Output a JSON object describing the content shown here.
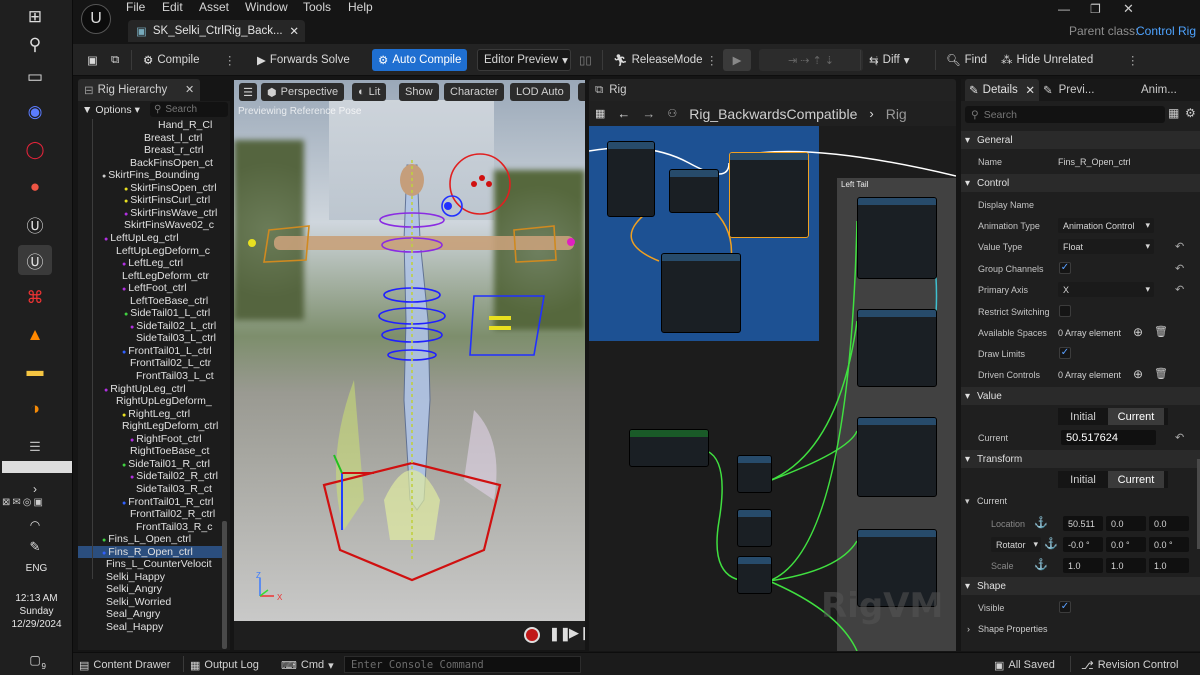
{
  "taskbar": {
    "lang": "ENG",
    "time": "12:13 AM",
    "day": "Sunday",
    "date": "12/29/2024",
    "notif_count": "9"
  },
  "menu": [
    "File",
    "Edit",
    "Asset",
    "Window",
    "Tools",
    "Help"
  ],
  "doc_tab": "SK_Selki_CtrlRig_Back...",
  "parent_class_label": "Parent class:",
  "parent_class_value": "Control Rig",
  "toolbar": {
    "compile": "Compile",
    "forwards_solve": "Forwards Solve",
    "auto_compile": "Auto Compile",
    "editor_preview": "Editor Preview",
    "release_mode": "ReleaseMode",
    "diff": "Diff",
    "find": "Find",
    "hide_unrelated": "Hide Unrelated"
  },
  "hierarchy": {
    "tab": "Rig Hierarchy",
    "options": "Options",
    "search_placeholder": "Search",
    "items": [
      "Hand_R_Cl",
      "Breast_l_ctrl",
      "Breast_r_ctrl",
      "BackFinsOpen_ct",
      "SkirtFins_Bounding",
      "SkirtFinsOpen_ctrl",
      "SkirtFinsCurl_ctrl",
      "SkirtFinsWave_ctrl",
      "SkirtFinsWave02_c",
      "LeftUpLeg_ctrl",
      "LeftUpLegDeform_c",
      "LeftLeg_ctrl",
      "LeftLegDeform_ctr",
      "LeftFoot_ctrl",
      "LeftToeBase_ctrl",
      "SideTail01_L_ctrl",
      "SideTail02_L_ctrl",
      "SideTail03_L_ctrl",
      "FrontTail01_L_ctrl",
      "FrontTail02_L_ctr",
      "FrontTail03_L_ct",
      "RightUpLeg_ctrl",
      "RightUpLegDeform_",
      "RightLeg_ctrl",
      "RightLegDeform_ctrl",
      "RightFoot_ctrl",
      "RightToeBase_ct",
      "SideTail01_R_ctrl",
      "SideTail02_R_ctrl",
      "SideTail03_R_ct",
      "FrontTail01_R_ctrl",
      "FrontTail02_R_ctrl",
      "FrontTail03_R_c",
      "Fins_L_Open_ctrl",
      "Fins_R_Open_ctrl",
      "Fins_L_CounterVelocit",
      "Selki_Happy",
      "Selki_Angry",
      "Selki_Worried",
      "Seal_Angry",
      "Seal_Happy"
    ]
  },
  "viewport": {
    "perspective": "Perspective",
    "lit": "Lit",
    "show": "Show",
    "character": "Character",
    "lod": "LOD Auto",
    "caption": "Previewing Reference Pose"
  },
  "graph": {
    "tab": "Rig",
    "breadcrumb_main": "Rig_BackwardsCompatible",
    "breadcrumb_next": "Rig",
    "comment_label": "Left Tail",
    "watermark": "RigVM"
  },
  "details": {
    "tabs": [
      "Details",
      "Previ...",
      "Anim..."
    ],
    "search_placeholder": "Search",
    "sections": {
      "general": "General",
      "control": "Control",
      "value": "Value",
      "transform": "Transform",
      "current": "Current",
      "shape": "Shape"
    },
    "name_label": "Name",
    "name_value": "Fins_R_Open_ctrl",
    "display_name": "Display Name",
    "animation_type": "Animation Type",
    "animation_type_value": "Animation Control",
    "value_type": "Value Type",
    "value_type_value": "Float",
    "group_channels": "Group Channels",
    "primary_axis": "Primary Axis",
    "primary_axis_value": "X",
    "restrict_switching": "Restrict Switching",
    "available_spaces": "Available Spaces",
    "available_spaces_value": "0 Array element",
    "draw_limits": "Draw Limits",
    "driven_controls": "Driven Controls",
    "driven_controls_value": "0 Array element",
    "initial": "Initial",
    "current": "Current",
    "current_label": "Current",
    "current_value": "50.517624",
    "location": "Location",
    "location_values": [
      "50.511",
      "0.0",
      "0.0"
    ],
    "rotator": "Rotator",
    "rotator_values": [
      "-0.0 °",
      "0.0 °",
      "0.0 °"
    ],
    "scale": "Scale",
    "scale_values": [
      "1.0",
      "1.0",
      "1.0"
    ],
    "visible": "Visible",
    "shape_properties": "Shape Properties"
  },
  "bottom": {
    "content_drawer": "Content Drawer",
    "output_log": "Output Log",
    "cmd": "Cmd",
    "console_placeholder": "Enter Console Command",
    "all_saved": "All Saved",
    "revision_control": "Revision Control"
  }
}
